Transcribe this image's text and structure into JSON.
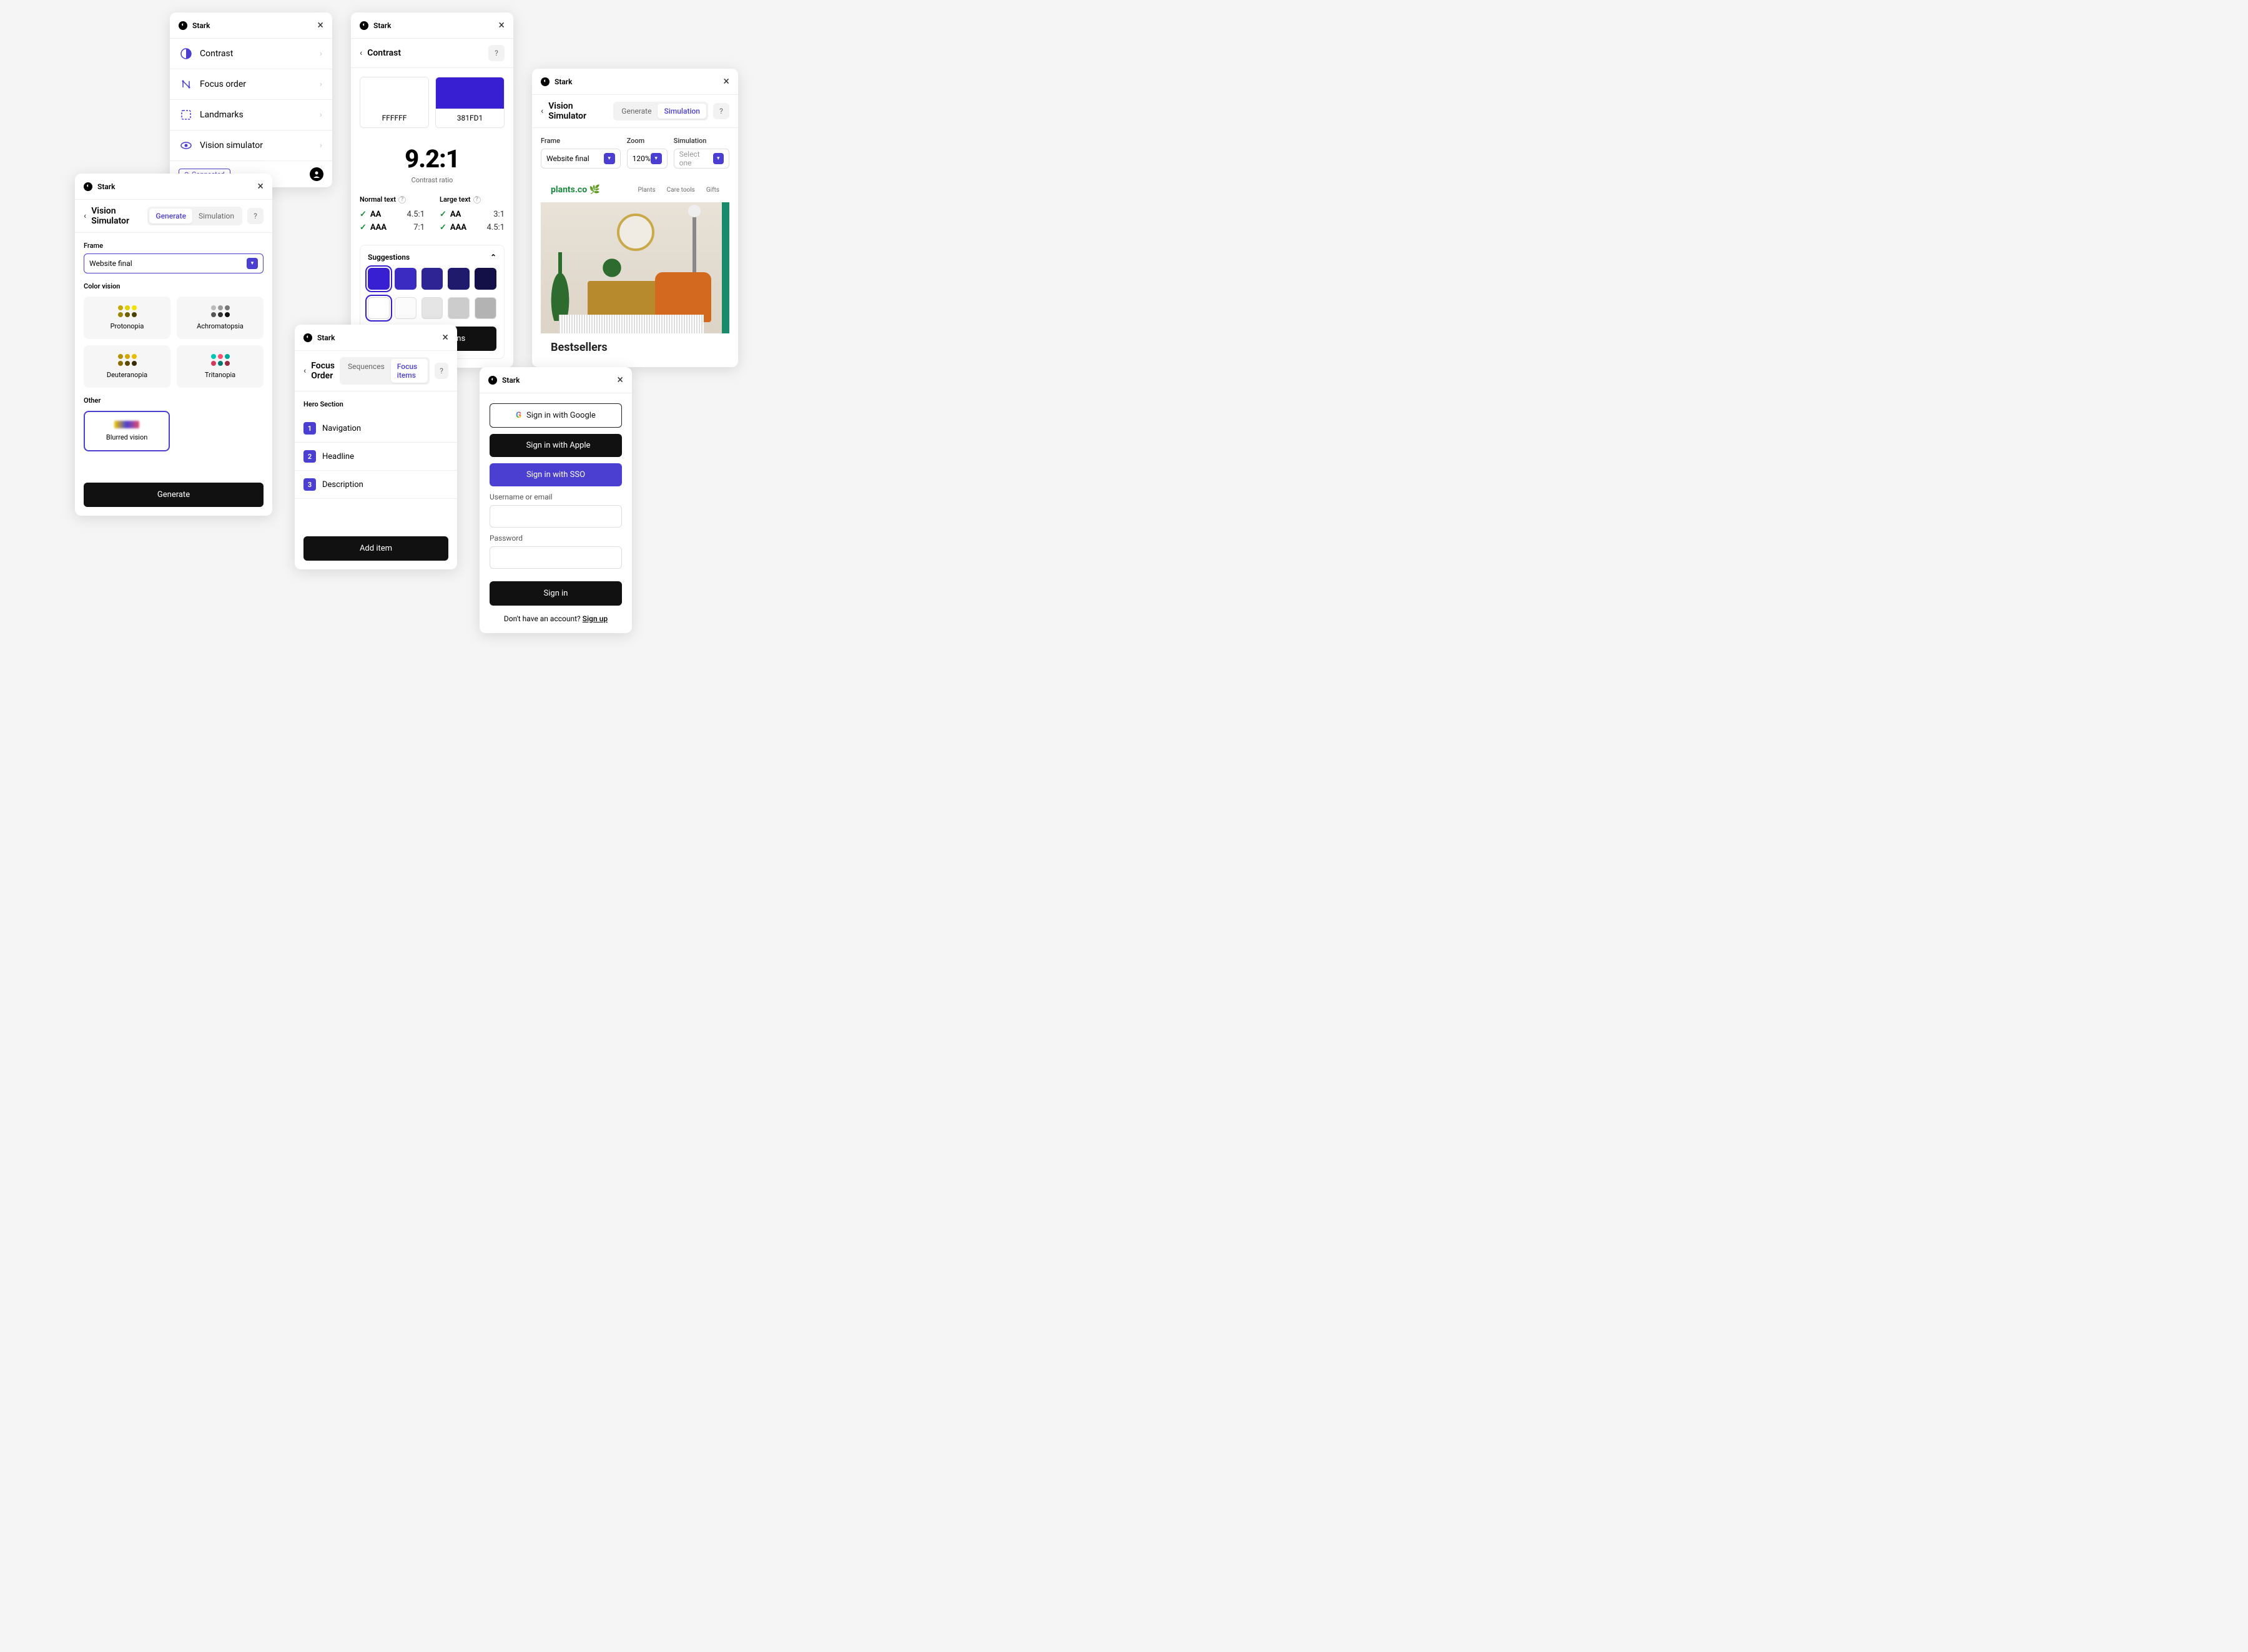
{
  "brand": "Stark",
  "menu_panel": {
    "items": [
      {
        "label": "Contrast",
        "icon": "contrast-icon"
      },
      {
        "label": "Focus order",
        "icon": "focus-order-icon"
      },
      {
        "label": "Landmarks",
        "icon": "landmarks-icon"
      },
      {
        "label": "Vision simulator",
        "icon": "vision-icon"
      }
    ],
    "footer_badge": "Connected"
  },
  "contrast_panel": {
    "title": "Contrast",
    "bg_hex": "FFFFFF",
    "fg_hex": "381FD1",
    "ratio": "9.2:1",
    "ratio_label": "Contrast ratio",
    "normal_label": "Normal text",
    "large_label": "Large text",
    "normal": [
      {
        "grade": "AA",
        "value": "4.5:1"
      },
      {
        "grade": "AAA",
        "value": "7:1"
      }
    ],
    "large": [
      {
        "grade": "AA",
        "value": "3:1"
      },
      {
        "grade": "AAA",
        "value": "4.5:1"
      }
    ],
    "suggestions_label": "Suggestions",
    "swatches_fg": [
      "#381FD1",
      "#3b2bc0",
      "#2e2494",
      "#1f1a6b",
      "#131047"
    ],
    "swatches_bg": [
      "#ffffff",
      "#fbfbfb",
      "#e5e5e5",
      "#cccccc",
      "#b3b3b3"
    ],
    "apply_label": "Apply suggestions"
  },
  "vision_preview_panel": {
    "title": "Vision Simulator",
    "tabs": [
      "Generate",
      "Simulation"
    ],
    "active_tab": 1,
    "controls": {
      "frame_label": "Frame",
      "frame_value": "Website final",
      "zoom_label": "Zoom",
      "zoom_value": "120%",
      "sim_label": "Simulation",
      "sim_placeholder": "Select one"
    },
    "site_brand": "plants.co",
    "site_nav": [
      "Plants",
      "Care tools",
      "Gifts"
    ],
    "bestsellers": "Bestsellers"
  },
  "vision_options_panel": {
    "title": "Vision Simulator",
    "tabs": [
      "Generate",
      "Simulation"
    ],
    "active_tab": 0,
    "frame_label": "Frame",
    "frame_value": "Website final",
    "color_vision_label": "Color vision",
    "options": [
      "Protonopia",
      "Achromatopsia",
      "Deuteranopia",
      "Tritanopia"
    ],
    "other_label": "Other",
    "other_option": "Blurred vision",
    "generate_btn": "Generate"
  },
  "focus_order_panel": {
    "title": "Focus Order",
    "tabs": [
      "Sequences",
      "Focus items"
    ],
    "active_tab": 1,
    "section": "Hero Section",
    "items": [
      "Navigation",
      "Headline",
      "Description"
    ],
    "add_btn": "Add item"
  },
  "signin_panel": {
    "google": "Sign in with Google",
    "apple": "Sign in with Apple",
    "sso": "Sign in with SSO",
    "username_label": "Username or email",
    "password_label": "Password",
    "submit": "Sign in",
    "no_account": "Don't have an account? ",
    "signup": "Sign up"
  }
}
